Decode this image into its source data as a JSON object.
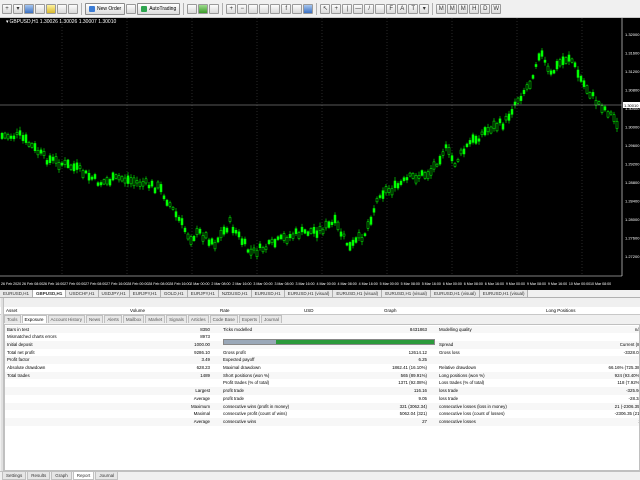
{
  "toolbar": {
    "new_order_label": "New Order",
    "autotrading_label": "AutoTrading"
  },
  "chart": {
    "symbol_title": "GBPUSD,H1  1.30026 1.30026 1.30007 1.30010",
    "current_price": "1.30010",
    "price_labels": [
      "1.32000",
      "1.31600",
      "1.31200",
      "1.30800",
      "1.30400",
      "1.30000",
      "1.29600",
      "1.29200",
      "1.28800",
      "1.28400",
      "1.28000",
      "1.27600",
      "1.27200"
    ],
    "time_labels": [
      "26 Feb 2020",
      "26 Feb 08:00",
      "26 Feb 16:00",
      "27 Feb 00:00",
      "27 Feb 08:00",
      "27 Feb 16:00",
      "28 Feb 00:00",
      "28 Feb 08:00",
      "28 Feb 16:00",
      "2 Mar 00:00",
      "2 Mar 08:00",
      "2 Mar 16:00",
      "3 Mar 00:00",
      "3 Mar 08:00",
      "3 Mar 16:00",
      "4 Mar 00:00",
      "4 Mar 08:00",
      "4 Mar 16:00",
      "5 Mar 00:00",
      "5 Mar 08:00",
      "5 Mar 16:00",
      "6 Mar 00:00",
      "6 Mar 08:00",
      "6 Mar 16:00",
      "9 Mar 00:00",
      "9 Mar 08:00",
      "9 Mar 16:00",
      "10 Mar 00:00",
      "10 Mar 08:00"
    ],
    "colors": {
      "background": "#000000",
      "candles": "#00ff00",
      "grid": "#444444",
      "text": "#ffffff"
    }
  },
  "chart_tabs": [
    "EURUSD,H1",
    "GBPUSD,H1",
    "USDCHF,H1",
    "USDJPY,H1",
    "EURJPY,H1",
    "GOLD,H1",
    "EURJPY,H1",
    "NZDUSD,H1",
    "EURUSD,H1",
    "EURUSD,H1 (visual)",
    "EURUSD,H1 (visual)",
    "EURUSD,H1 (visual)",
    "EURUSD,H1 (visual)",
    "EURUSD,H1 (visual)"
  ],
  "panel": {
    "columns": [
      "Asset",
      "Volume",
      "Rate",
      "USD",
      "Graph",
      "Long Positions"
    ],
    "subtabs": [
      "Tools",
      "Exposure",
      "Account History",
      "News",
      "Alerts",
      "Mailbox",
      "Market",
      "Signals",
      "Articles",
      "Code Base",
      "Experts",
      "Journal"
    ]
  },
  "report": {
    "rows": [
      {
        "a": "Bars in test",
        "b": "8350",
        "c": "Ticks modelled",
        "d": "8431863",
        "e": "Modelling quality",
        "f": "n/a"
      },
      {
        "a": "Mismatched charts errors",
        "b": "8973",
        "c": "",
        "d": "",
        "e": "",
        "f": ""
      },
      {
        "a": "Initial deposit",
        "b": "1000.00",
        "c": "",
        "d": "",
        "e": "Spread",
        "f": "Current (8)"
      },
      {
        "a": "Total net profit",
        "b": "9286.10",
        "c": "Gross profit",
        "d": "12614.12",
        "e": "Gross loss",
        "f": "-3328.02"
      },
      {
        "a": "Profit factor",
        "b": "3.49",
        "c": "Expected payoff",
        "d": "6.25",
        "e": "",
        "f": ""
      },
      {
        "a": "Absolute drawdown",
        "b": "628.23",
        "c": "Maximal drawdown",
        "d": "1862.41 (16.10%)",
        "e": "Relative drawdown",
        "f": "66.16% (725.38)"
      },
      {
        "a": "Total trades",
        "b": "1489",
        "c": "Short positions (won %)",
        "d": "565 (89.91%)",
        "e": "Long positions (won %)",
        "f": "924 (93.40%)"
      },
      {
        "a": "",
        "b": "",
        "c": "Profit trades (% of total)",
        "d": "1371 (92.08%)",
        "e": "Loss trades (% of total)",
        "f": "118 (7.92%)"
      },
      {
        "a": "",
        "b": "Largest",
        "c": "profit trade",
        "d": "116.16",
        "e": "loss trade",
        "f": "-325.94"
      },
      {
        "a": "",
        "b": "Average",
        "c": "profit trade",
        "d": "9.05",
        "e": "loss trade",
        "f": "-28.34"
      },
      {
        "a": "",
        "b": "Maximum",
        "c": "consecutive wins (profit in money)",
        "d": "321 (3062.34)",
        "e": "consecutive losses (loss in money)",
        "f": "21 (-2306.35)"
      },
      {
        "a": "",
        "b": "Maximal",
        "c": "consecutive profit (count of wins)",
        "d": "5062.04 (321)",
        "e": "consecutive loss (count of losses)",
        "f": "-2306.35 (21)"
      },
      {
        "a": "",
        "b": "Average",
        "c": "consecutive wins",
        "d": "27",
        "e": "consecutive losses",
        "f": "2"
      }
    ]
  },
  "bottom_tabs": [
    "Settings",
    "Results",
    "Graph",
    "Report",
    "Journal"
  ]
}
